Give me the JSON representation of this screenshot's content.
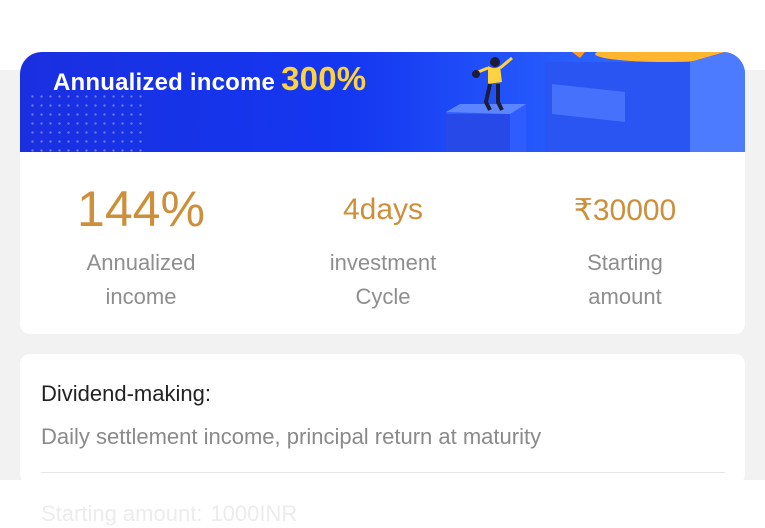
{
  "banner": {
    "title_prefix": "Annualized income",
    "title_highlight": "300%"
  },
  "stats": [
    {
      "value": "144%",
      "label_line1": "Annualized",
      "label_line2": "income"
    },
    {
      "value": "4days",
      "label_line1": "investment",
      "label_line2": "Cycle"
    },
    {
      "value": "₹30000",
      "label_line1": "Starting",
      "label_line2": "amount"
    }
  ],
  "info": {
    "title": "Dividend-making:",
    "text": "Daily settlement income, principal return at maturity"
  },
  "partial_row": {
    "label": "Starting amount:",
    "value": "1000INR"
  },
  "colors": {
    "accent_gold": "#cd8f3a",
    "banner_blue": "#1437f0",
    "highlight_yellow": "#ffd23f",
    "muted_text": "#8e8e8e"
  }
}
